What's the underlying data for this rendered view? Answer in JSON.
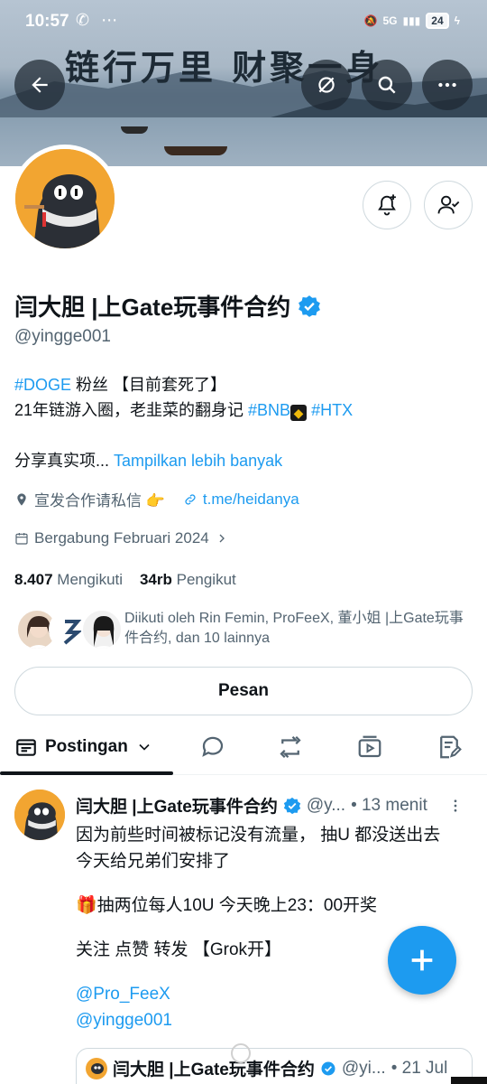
{
  "status_bar": {
    "time": "10:57",
    "left_icons": "✆ ⋯",
    "network": "5G",
    "battery": "24"
  },
  "banner": {
    "calligraphy": "链行万里  财聚一身"
  },
  "profile": {
    "name": "闫大胆 |上Gate玩事件合约",
    "handle": "@yingge001",
    "bio_tag1": "#DOGE",
    "bio_line1_rest": " 粉丝 【目前套死了】",
    "bio_line2_text": "21年链游入圈，老韭菜的翻身记 ",
    "bio_tag_bnb": "#BNB",
    "bio_tag_htx": "#HTX",
    "bio_line3_text": "分享真实项... ",
    "show_more": "Tampilkan lebih banyak",
    "location": "宣发合作请私信 👉",
    "website": "t.me/heidanya",
    "joined": "Bergabung Februari 2024",
    "following_count": "8.407",
    "following_label": "Mengikuti",
    "followers_count": "34rb",
    "followers_label": "Pengikut",
    "followed_by": "Diikuti oleh Rin Femin, ProFeeX, 董小姐 |上Gate玩事件合约, dan 10 lainnya",
    "message_button": "Pesan"
  },
  "tabs": {
    "active": "Postingan"
  },
  "post": {
    "author": "闫大胆 |上Gate玩事件合约",
    "handle": "@y...",
    "time": "• 13 menit",
    "line1": "因为前些时间被标记没有流量， 抽U 都没送出去",
    "line2": "今天给兄弟们安排了",
    "line3": "🎁抽两位每人10U     今天晚上23：00开奖",
    "line4": "关注 点赞  转发  【Grok开】",
    "mention1": "@Pro_FeeX",
    "mention2": "@yingge001",
    "quoted_author": "闫大胆 |上Gate玩事件合约",
    "quoted_handle": "@yi...",
    "quoted_time": "• 21 Jul"
  },
  "colors": {
    "accent": "#1d9bf0",
    "avatar_orange": "#f2a531"
  }
}
